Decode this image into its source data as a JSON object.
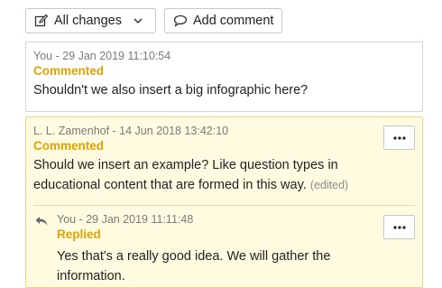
{
  "toolbar": {
    "filter_label": "All changes",
    "add_comment_label": "Add comment"
  },
  "comments": [
    {
      "meta": "You - 29 Jan 2019 11:10:54",
      "status": "Commented",
      "text": "Shouldn't we also insert a big infographic here?"
    },
    {
      "meta": "L. L. Zamenhof - 14 Jun 2018 13:42:10",
      "status": "Commented",
      "text": "Should we insert an example? Like question types in educational content that are formed in this way.",
      "edited": "(edited)",
      "reply": {
        "meta": "You - 29 Jan 2019 11:11:48",
        "status": "Replied",
        "text": "Yes that's a really good idea. We will gather the information."
      }
    }
  ],
  "colors": {
    "accent": "#e1a100",
    "active_bg": "#fffbe0",
    "active_border": "#f0d77e"
  }
}
